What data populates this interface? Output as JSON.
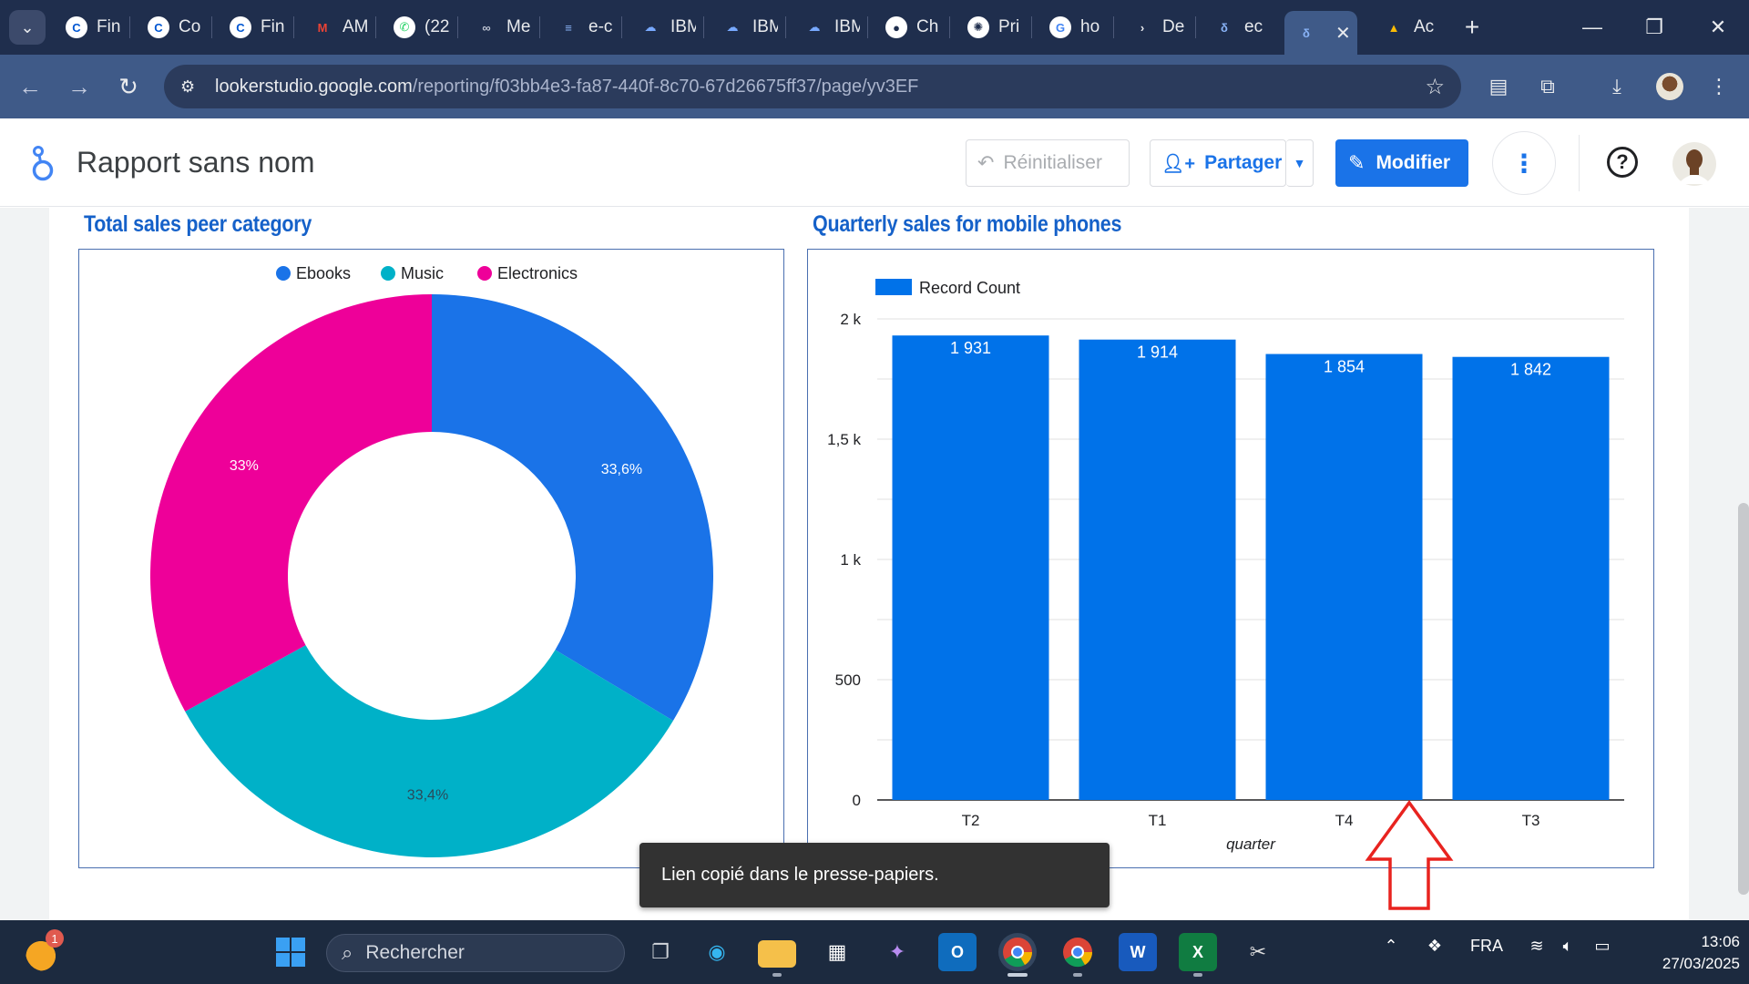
{
  "browser": {
    "tabs": [
      {
        "label": "Fin",
        "icon": "coursera-icon"
      },
      {
        "label": "Co",
        "icon": "coursera-icon"
      },
      {
        "label": "Fin",
        "icon": "coursera-icon"
      },
      {
        "label": "AM",
        "icon": "gmail-icon"
      },
      {
        "label": "(22",
        "icon": "whatsapp-icon"
      },
      {
        "label": "Me",
        "icon": "link-icon"
      },
      {
        "label": "e-c",
        "icon": "list-icon"
      },
      {
        "label": "IBM",
        "icon": "ibm-cloud-icon"
      },
      {
        "label": "IBM",
        "icon": "ibm-cloud-icon"
      },
      {
        "label": "IBM",
        "icon": "ibm-cloud-icon"
      },
      {
        "label": "Ch",
        "icon": "github-icon"
      },
      {
        "label": "Pri",
        "icon": "openai-icon"
      },
      {
        "label": "ho",
        "icon": "google-icon"
      },
      {
        "label": "De",
        "icon": "play-icon"
      },
      {
        "label": "ec",
        "icon": "looker-icon"
      },
      {
        "label": "",
        "icon": "looker-icon",
        "active": true
      },
      {
        "label": "Ac",
        "icon": "drive-icon"
      }
    ],
    "url_domain": "lookerstudio.google.com",
    "url_path": "/reporting/f03bb4e3-fa87-440f-8c70-67d26675ff37/page/yv3EF"
  },
  "app": {
    "report_title": "Rapport sans nom",
    "reset_label": "Réinitialiser",
    "share_label": "Partager",
    "edit_label": "Modifier",
    "help_glyph": "?"
  },
  "colors": {
    "ebooks": "#1a73e8",
    "music": "#00b1c8",
    "electronics": "#ee0099",
    "bar": "#0072e9",
    "title": "#1561c9"
  },
  "donut": {
    "title": "Total sales peer category",
    "chart_data": {
      "type": "pie",
      "categories": [
        "Ebooks",
        "Music",
        "Electronics"
      ],
      "values": [
        33.6,
        33.4,
        33.0
      ],
      "labels": [
        "33,6%",
        "33,4%",
        "33%"
      ],
      "legend": "top"
    }
  },
  "bars": {
    "title": "Quarterly sales for mobile phones",
    "chart_data": {
      "type": "bar",
      "categories": [
        "T2",
        "T1",
        "T4",
        "T3"
      ],
      "series": [
        {
          "name": "Record Count",
          "values": [
            1931,
            1914,
            1854,
            1842
          ]
        }
      ],
      "value_labels": [
        "1 931",
        "1 914",
        "1 854",
        "1 842"
      ],
      "yticks": [
        0,
        500,
        1000,
        1500,
        2000
      ],
      "ytick_labels": [
        "0",
        "500",
        "1 k",
        "1,5 k",
        "2 k"
      ],
      "ylim": [
        0,
        2000
      ],
      "xlabel": "quarter",
      "ylabel": "",
      "legend": "top-left",
      "grid": true
    }
  },
  "toast": {
    "message": "Lien copié dans le presse-papiers."
  },
  "taskbar": {
    "search_placeholder": "Rechercher",
    "language": "FRA",
    "time": "13:06",
    "date": "27/03/2025",
    "notification_count": "1"
  }
}
